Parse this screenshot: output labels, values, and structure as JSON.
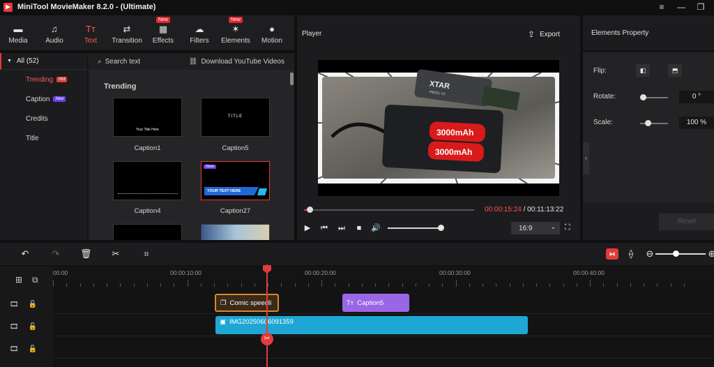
{
  "window": {
    "title": "MiniTool MovieMaker 8.2.0 - (Ultimate)",
    "menu_icon": "hamburger-menu-icon",
    "minimize_icon": "minimize-icon",
    "maximize_icon": "maximize-icon"
  },
  "toolbar": {
    "items": [
      {
        "label": "Media",
        "icon": "folder-icon"
      },
      {
        "label": "Audio",
        "icon": "music-note-icon"
      },
      {
        "label": "Text",
        "icon": "text-icon",
        "active": true
      },
      {
        "label": "Transition",
        "icon": "transition-icon"
      },
      {
        "label": "Effects",
        "icon": "effects-icon",
        "badge": "New"
      },
      {
        "label": "Filters",
        "icon": "filters-icon"
      },
      {
        "label": "Elements",
        "icon": "elements-icon",
        "badge": "New"
      },
      {
        "label": "Motion",
        "icon": "motion-icon"
      }
    ]
  },
  "categories": {
    "all_label": "All (52)",
    "items": [
      {
        "label": "Trending",
        "tag": "Hot",
        "active": true
      },
      {
        "label": "Caption",
        "tag": "New"
      },
      {
        "label": "Credits"
      },
      {
        "label": "Title"
      }
    ]
  },
  "content": {
    "search_placeholder": "Search text",
    "download_label": "Download YouTube Videos",
    "section_title": "Trending",
    "thumbnails": [
      {
        "label": "Caption1",
        "preview_text": "Your Title Here"
      },
      {
        "label": "Caption5",
        "preview_text": "TITLE"
      },
      {
        "label": "Caption4",
        "preview_text": ""
      },
      {
        "label": "Caption27",
        "preview_text": "YOUR TEXT HERE",
        "badge": "New"
      }
    ]
  },
  "player": {
    "title": "Player",
    "export_label": "Export",
    "current_time": "00:00:15:24",
    "total_time": "/ 00:11:13:22",
    "progress": 0.023,
    "volume": 1.0,
    "aspect_ratio": "16:9",
    "video_text": {
      "brand": "XTAR",
      "model": "PB2SL V2",
      "capacity_1": "3000mAh",
      "capacity_2": "3000mAh"
    }
  },
  "properties": {
    "title": "Elements Property",
    "flip_label": "Flip:",
    "rotate_label": "Rotate:",
    "rotate_value": "0 °",
    "scale_label": "Scale:",
    "scale_value": "100 %",
    "reset_label": "Reset"
  },
  "timeline": {
    "ruler_labels": [
      "00:00",
      "00:00:10:00",
      "00:00:20:00",
      "00:00:30:00",
      "00:00:40:00"
    ],
    "clips": [
      {
        "track": 1,
        "label": "Comic speedli",
        "color": "#d9862a"
      },
      {
        "track": 1,
        "label": "Caption5",
        "color": "#9a66e6"
      },
      {
        "track": 2,
        "label": "IMG20250606091359",
        "color": "#1ea6d4"
      }
    ]
  },
  "colors": {
    "accent": "#e43a3a",
    "new_badge": "#6c3ef0",
    "clip_video": "#1ea6d4",
    "clip_caption": "#9a66e6",
    "clip_effect": "#d9862a"
  }
}
